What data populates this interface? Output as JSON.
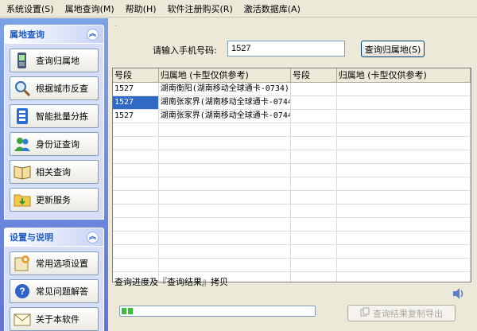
{
  "menu": [
    {
      "label": "系统设置(S)"
    },
    {
      "label": "属地查询(M)"
    },
    {
      "label": "帮助(H)"
    },
    {
      "label": "软件注册购买(R)"
    },
    {
      "label": "激活数据库(A)"
    }
  ],
  "sidebar": {
    "group1": {
      "title": "属地查询",
      "items": [
        {
          "label": "查询归属地",
          "icon": "mobile-phone-icon"
        },
        {
          "label": "根据城市反查",
          "icon": "magnifier-icon"
        },
        {
          "label": "智能批量分拣",
          "icon": "sort-icon"
        },
        {
          "label": "身份证查询",
          "icon": "users-icon"
        },
        {
          "label": "相关查询",
          "icon": "book-icon"
        },
        {
          "label": "更新服务",
          "icon": "folder-update-icon"
        }
      ]
    },
    "group2": {
      "title": "设置与说明",
      "items": [
        {
          "label": "常用选项设置",
          "icon": "settings-icon"
        },
        {
          "label": "常见问题解答",
          "icon": "help-icon"
        },
        {
          "label": "关于本软件",
          "icon": "mail-icon"
        }
      ]
    }
  },
  "query": {
    "label": "请输入手机号码:",
    "value": "1527",
    "button": "查询归属地(S)"
  },
  "table": {
    "headers": [
      "号段",
      "归属地 (卡型仅供参考)",
      "号段",
      "归属地 (卡型仅供参考)"
    ],
    "rows": [
      [
        "1527",
        "湖南衡阳(湖南移动全球通卡-0734)",
        "",
        ""
      ],
      [
        "1527",
        "湖南张家界(湖南移动全球通卡-0744",
        "",
        ""
      ],
      [
        "1527",
        "湖南张家界(湖南移动全球通卡-0744",
        "",
        ""
      ]
    ],
    "selected_row": 1
  },
  "status": {
    "text": "查询进度及『查询结果』拷贝",
    "progress_percent": 8,
    "export_button": "查询结果复制导出"
  },
  "colors": {
    "accent": "#215DC6",
    "progress": "#37C037",
    "selection": "#316AC5"
  }
}
